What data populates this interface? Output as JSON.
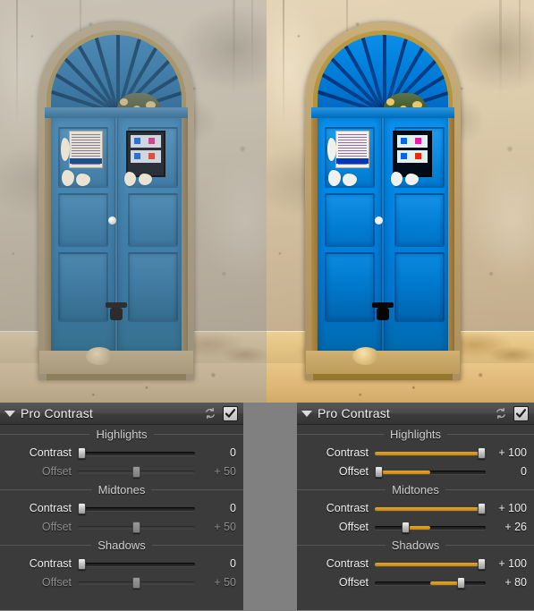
{
  "photos": {
    "before": {
      "name": "before-image",
      "alt": "Blue arched wooden door in weathered stucco wall, original"
    },
    "after": {
      "name": "after-image",
      "alt": "Blue arched wooden door in weathered stucco wall, Pro Contrast applied"
    }
  },
  "panels": [
    {
      "id": "left",
      "title": "Pro Contrast",
      "collapse_glyph": "triangle-down",
      "reset_icon": "reset-icon",
      "enabled_checkbox": true,
      "sections": [
        {
          "label": "Highlights",
          "rows": [
            {
              "label": "Contrast",
              "value": "0",
              "pos": 0,
              "fill_from": 0,
              "dim": false
            },
            {
              "label": "Offset",
              "value": "+ 50",
              "pos": 50,
              "fill_from": 50,
              "dim": true
            }
          ]
        },
        {
          "label": "Midtones",
          "rows": [
            {
              "label": "Contrast",
              "value": "0",
              "pos": 0,
              "fill_from": 0,
              "dim": false
            },
            {
              "label": "Offset",
              "value": "+ 50",
              "pos": 50,
              "fill_from": 50,
              "dim": true
            }
          ]
        },
        {
          "label": "Shadows",
          "rows": [
            {
              "label": "Contrast",
              "value": "0",
              "pos": 0,
              "fill_from": 0,
              "dim": false
            },
            {
              "label": "Offset",
              "value": "+ 50",
              "pos": 50,
              "fill_from": 50,
              "dim": true
            }
          ]
        }
      ]
    },
    {
      "id": "right",
      "title": "Pro Contrast",
      "collapse_glyph": "triangle-down",
      "reset_icon": "reset-icon",
      "enabled_checkbox": true,
      "sections": [
        {
          "label": "Highlights",
          "rows": [
            {
              "label": "Contrast",
              "value": "+ 100",
              "pos": 100,
              "fill_from": 0,
              "dim": false
            },
            {
              "label": "Offset",
              "value": "0",
              "pos": 0,
              "fill_from": 50,
              "dim": false
            }
          ]
        },
        {
          "label": "Midtones",
          "rows": [
            {
              "label": "Contrast",
              "value": "+ 100",
              "pos": 100,
              "fill_from": 0,
              "dim": false
            },
            {
              "label": "Offset",
              "value": "+ 26",
              "pos": 26,
              "fill_from": 50,
              "dim": false
            }
          ]
        },
        {
          "label": "Shadows",
          "rows": [
            {
              "label": "Contrast",
              "value": "+ 100",
              "pos": 100,
              "fill_from": 0,
              "dim": false
            },
            {
              "label": "Offset",
              "value": "+ 80",
              "pos": 80,
              "fill_from": 50,
              "dim": false
            }
          ]
        }
      ]
    }
  ],
  "colors": {
    "accent": "#e3a72c",
    "panel_bg": "#3b3b3b",
    "titlebar": "#4a4a4a",
    "gutter": "#808080",
    "text": "#f0f0f0",
    "text_dim": "#8f8f8f",
    "door_blue": "#4483ae",
    "wall": "#c4bcad"
  }
}
